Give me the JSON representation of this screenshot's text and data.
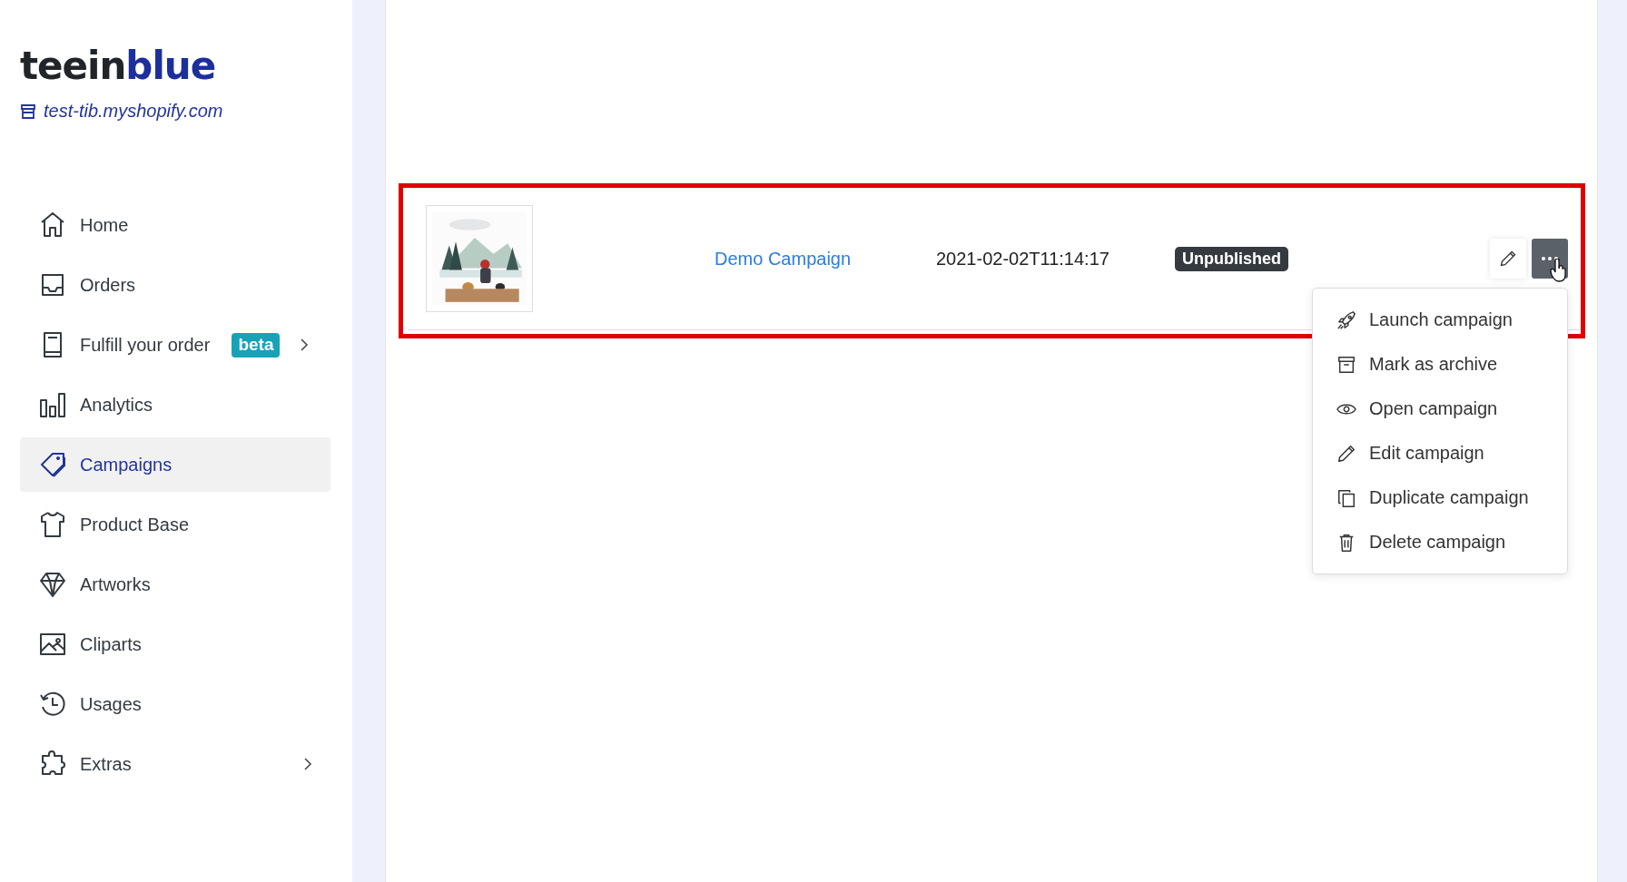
{
  "logo": {
    "dark_part": "teein",
    "accent_part": "blue"
  },
  "store_link": "test-tib.myshopify.com",
  "sidebar": {
    "items": [
      {
        "label": "Home",
        "selected": false
      },
      {
        "label": "Orders",
        "selected": false
      },
      {
        "label": "Fulfill your order",
        "selected": false,
        "badge": "beta",
        "expandable": true
      },
      {
        "label": "Analytics",
        "selected": false
      },
      {
        "label": "Campaigns",
        "selected": true
      },
      {
        "label": "Product Base",
        "selected": false
      },
      {
        "label": "Artworks",
        "selected": false
      },
      {
        "label": "Cliparts",
        "selected": false
      },
      {
        "label": "Usages",
        "selected": false
      },
      {
        "label": "Extras",
        "selected": false,
        "expandable": true
      }
    ]
  },
  "campaign_row": {
    "highlighted": true,
    "name": "Demo Campaign",
    "date": "2021-02-02T11:14:17",
    "status": "Unpublished",
    "more_open": true
  },
  "actions_menu": {
    "items": [
      {
        "label": "Launch campaign"
      },
      {
        "label": "Mark as archive"
      },
      {
        "label": "Open campaign"
      },
      {
        "label": "Edit campaign"
      },
      {
        "label": "Duplicate campaign"
      },
      {
        "label": "Delete campaign"
      }
    ]
  }
}
